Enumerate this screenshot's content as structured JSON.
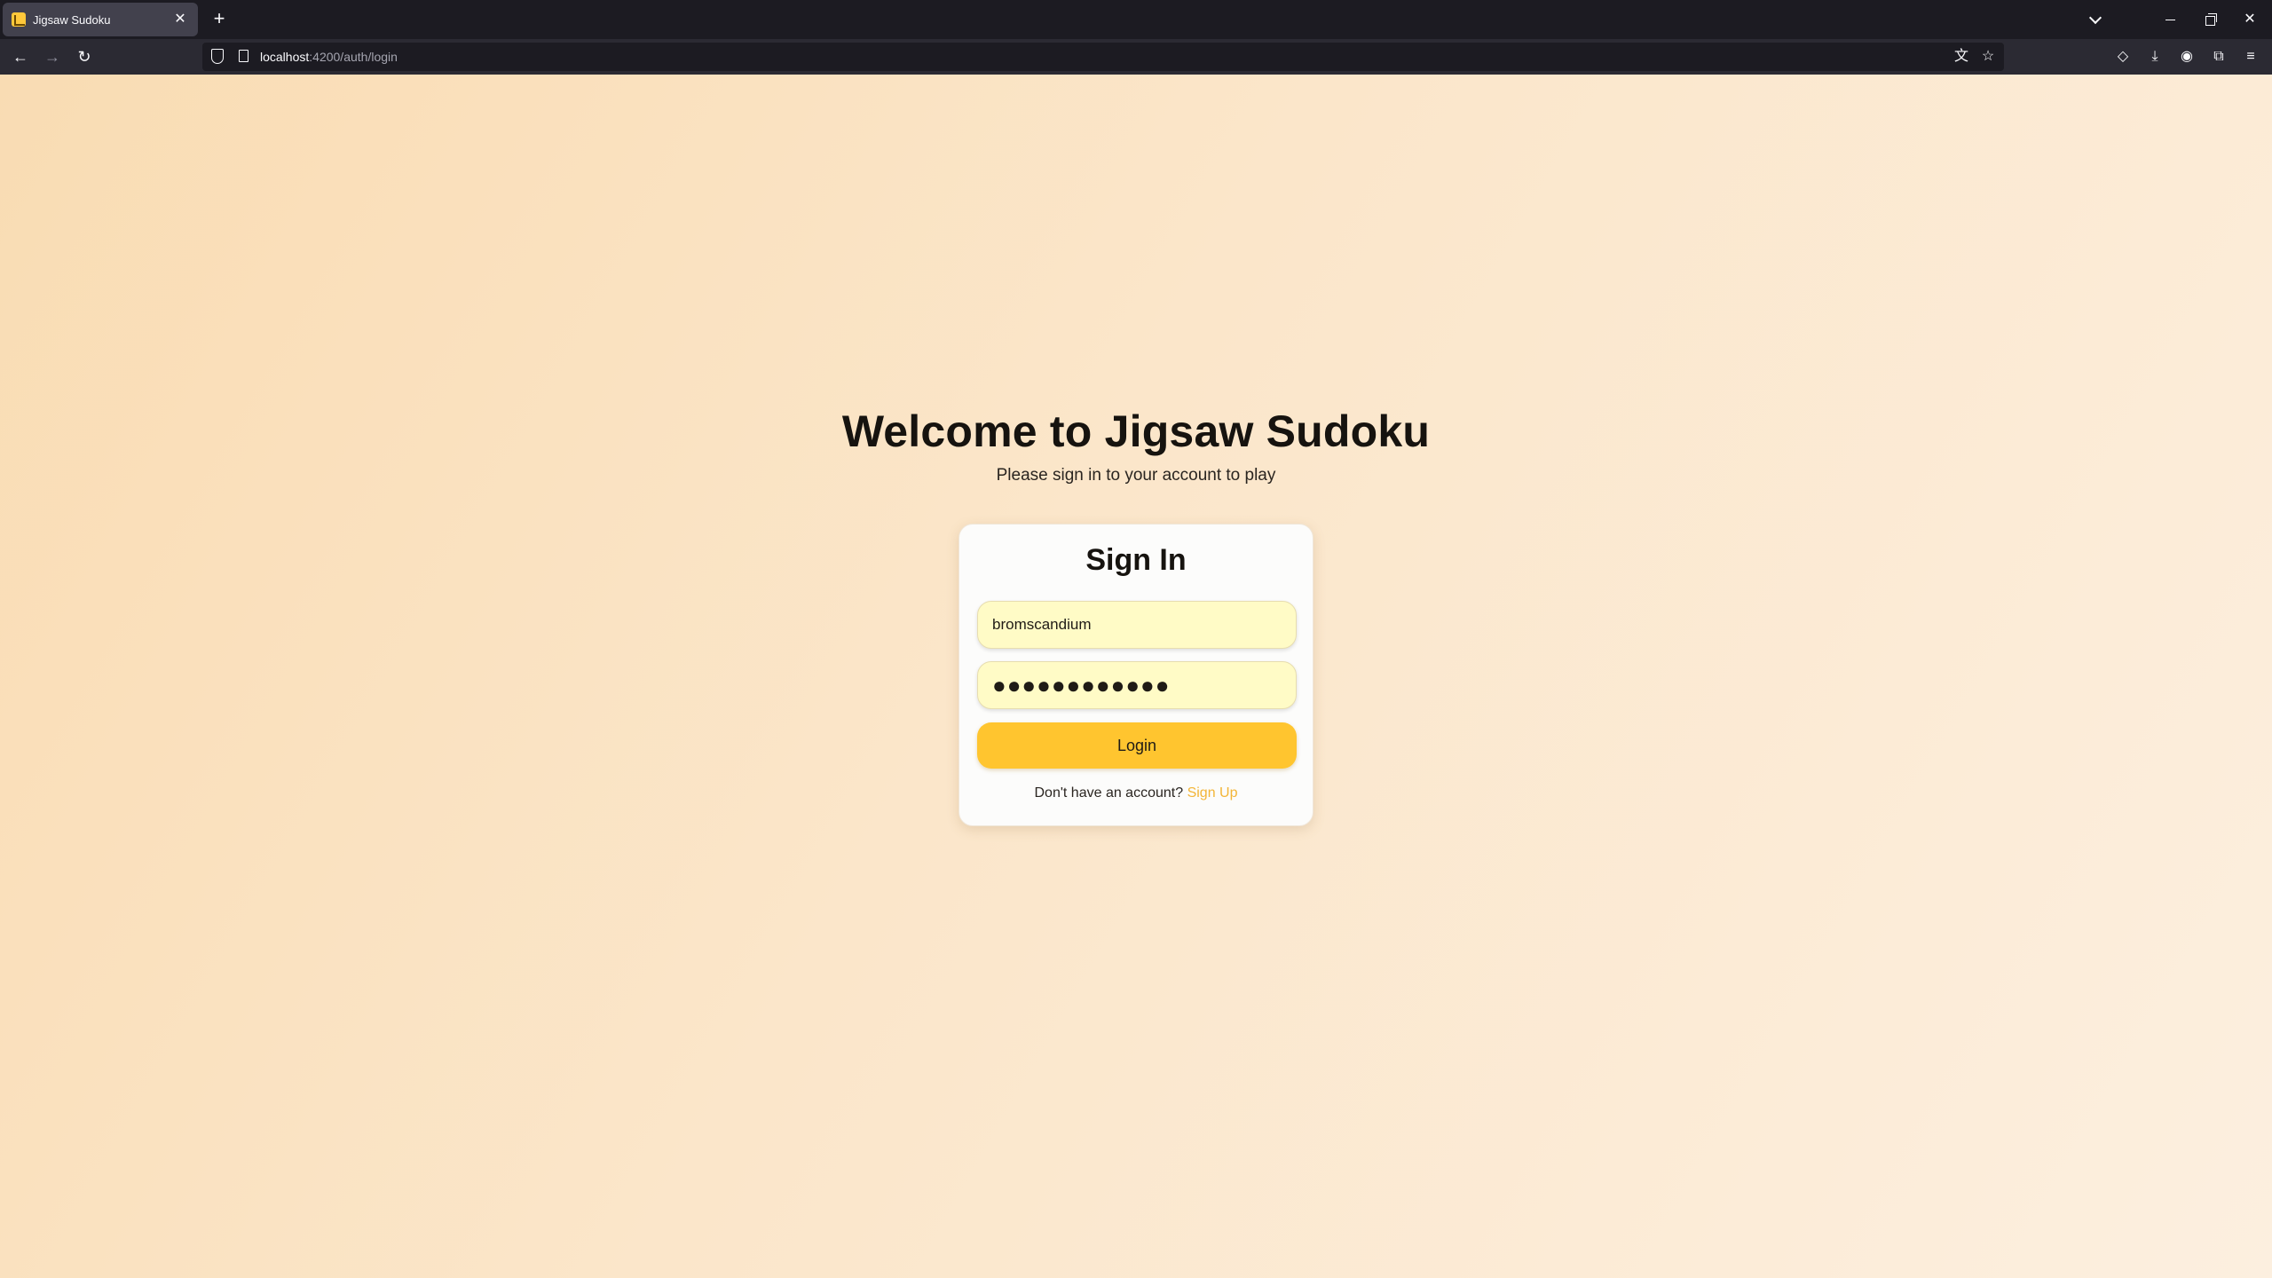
{
  "browser": {
    "tab": {
      "title": "Jigsaw Sudoku",
      "close_glyph": "✕"
    },
    "new_tab_glyph": "+",
    "window_controls": {
      "close_glyph": "✕"
    },
    "nav": {
      "back_glyph": "←",
      "forward_glyph": "→",
      "reload_glyph": "↻"
    },
    "url": {
      "host": "localhost",
      "path": ":4200/auth/login"
    },
    "toolbar_icons": [
      "translate-icon",
      "bookmark-star-icon",
      "pocket-icon",
      "download-icon",
      "account-icon",
      "extensions-icon",
      "menu-icon"
    ],
    "glyphs": {
      "translate": "文",
      "bookmark": "☆",
      "pocket": "◇",
      "download": "⤓",
      "account": "◉",
      "extensions": "⧉",
      "menu": "≡"
    }
  },
  "page": {
    "title": "Welcome to Jigsaw Sudoku",
    "subtitle": "Please sign in to your account to play"
  },
  "signin": {
    "heading": "Sign In",
    "username_value": "bromscandium",
    "password_mask": "●●●●●●●●●●●●",
    "login_label": "Login",
    "footer_text": "Don't have an account?",
    "signup_label": "Sign Up"
  },
  "colors": {
    "accent": "#ffc52f",
    "link": "#f3b537",
    "input_bg": "#fffbc6",
    "background_start": "#f9dcb3",
    "background_end": "#fcefdf"
  }
}
